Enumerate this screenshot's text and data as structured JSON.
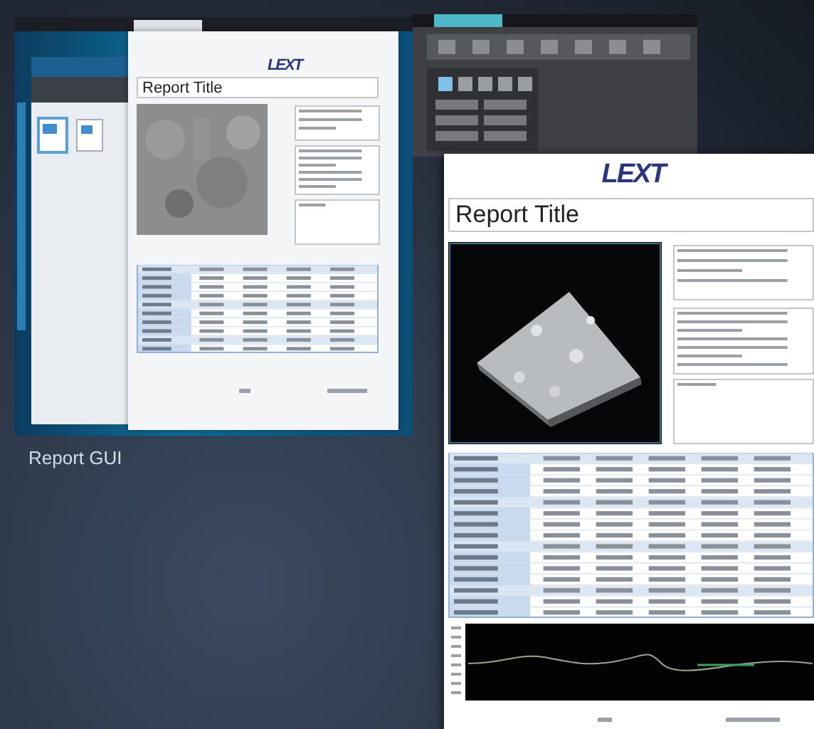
{
  "report_gui": {
    "logo": "LEXT",
    "title": "Report Title"
  },
  "caption": "Report GUI",
  "report_sheet": {
    "logo": "LEXT",
    "title": "Report Title"
  }
}
